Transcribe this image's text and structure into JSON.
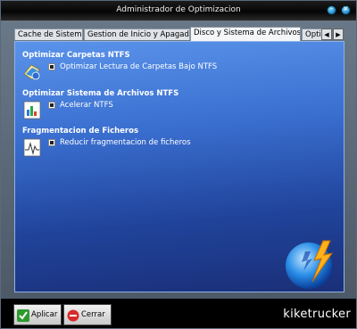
{
  "window": {
    "title": "Administrador de Optimizacion"
  },
  "tabs": [
    {
      "label": "Cache de Sistema"
    },
    {
      "label": "Gestion de Inicio y Apagado"
    },
    {
      "label": "Disco y Sistema de Archivos"
    },
    {
      "label": "Optim"
    }
  ],
  "sections": [
    {
      "title": "Optimizar Carpetas NTFS",
      "option": "Optimizar Lectura de Carpetas Bajo NTFS",
      "icon": "folder-optimize-icon"
    },
    {
      "title": "Optimizar Sistema de Archivos NTFS",
      "option": "Acelerar NTFS",
      "icon": "chart-document-icon"
    },
    {
      "title": "Fragmentacion de Ficheros",
      "option": "Reducir fragmentacion de ficheros",
      "icon": "fragment-document-icon"
    }
  ],
  "buttons": {
    "apply": "Aplicar",
    "close": "Cerrar"
  },
  "watermark": "kiketrucker",
  "colors": {
    "panel_top": "#5a93ea",
    "panel_bottom": "#1a2f78",
    "titlebar": "#050505"
  }
}
